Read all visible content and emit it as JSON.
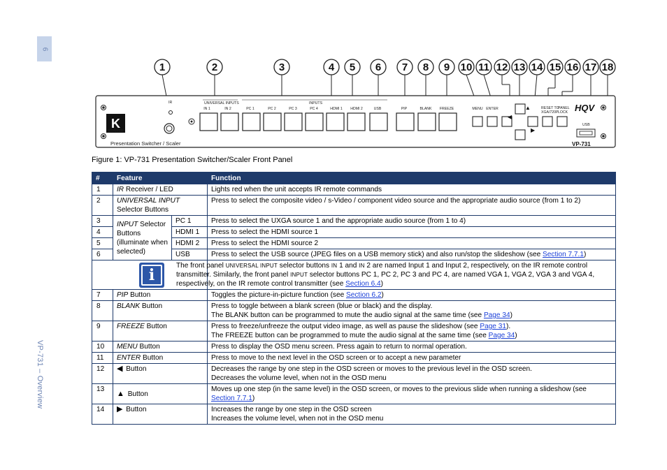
{
  "page": {
    "number": "6",
    "side_caption": "VP-731 – Overview"
  },
  "panel": {
    "callouts": [
      "1",
      "2",
      "3",
      "4",
      "5",
      "6",
      "7",
      "8",
      "9",
      "10",
      "11",
      "12",
      "13",
      "14",
      "15",
      "16",
      "17",
      "18"
    ],
    "ir_label": "IR",
    "universal_inputs_label": "UNIVERSAL INPUTS",
    "inputs_label": "INPUTS",
    "button_labels": [
      "IN 1",
      "IN 2",
      "PC 1",
      "PC 2",
      "PC 3",
      "PC 4",
      "HDMI 1",
      "HDMI 2",
      "USB",
      "PIP",
      "BLANK",
      "FREEZE",
      "MENU",
      "ENTER"
    ],
    "reset_label": "RESET TO",
    "reset_label2": "XGA/720P",
    "panel_lock_label": "PANEL",
    "panel_lock_label2": "LOCK",
    "usb_label": "USB",
    "hqv_logo": "HQV",
    "model": "VP-731",
    "brand_caption": "Presentation Switcher / Scaler",
    "brand_small": "KRAMER"
  },
  "figure_caption": "Figure 1: VP-731 Presentation Switcher/Scaler Front Panel",
  "table": {
    "headers": [
      "#",
      "Feature",
      "Function"
    ],
    "rows": {
      "r1": {
        "num": "1",
        "feature_em": "IR",
        "feature": " Receiver / LED",
        "function": "Lights red when the unit accepts IR remote commands"
      },
      "r2": {
        "num": "2",
        "feature_em": "UNIVERSAL INPUT",
        "feature": "Selector Buttons",
        "function": "Press to select the composite video / s-Video / component video source and the appropriate audio source (from 1 to 2)"
      },
      "r3": {
        "num": "3",
        "group_em": "INPUT",
        "group": " Selector Buttons (illuminate when selected)",
        "sub": "PC 1",
        "function": "Press to select the UXGA source 1 and the appropriate audio source (from 1 to 4)"
      },
      "r4": {
        "num": "4",
        "sub": "HDMI 1",
        "function": "Press to select the HDMI source 1"
      },
      "r5": {
        "num": "5",
        "sub": "HDMI 2",
        "function": "Press to select the HDMI source 2"
      },
      "r6": {
        "num": "6",
        "sub": "USB",
        "function": "Press to select the USB source (JPEG files on a USB memory stick) and also run/stop the slideshow (see ",
        "link": "Section 7.7.1",
        "tail": ")"
      },
      "note": {
        "t1": "The front panel ",
        "sc1": "UNIVERSAL INPUT",
        "t2": " selector buttons ",
        "sc2": "IN",
        "t3": " 1 and ",
        "sc3": "IN",
        "t4": " 2 are named Input 1 and Input 2, respectively, on the IR remote control transmitter. Similarly, the front panel ",
        "sc4": "INPUT",
        "t5": " selector buttons PC 1, PC 2, PC 3 and PC 4, are named VGA 1, VGA 2, VGA 3 and VGA 4, respectively, on the IR remote control transmitter (see ",
        "link": "Section 6.4",
        "t6": ")"
      },
      "r7": {
        "num": "7",
        "feature_em": "PIP",
        "feature": " Button",
        "function": "Toggles the picture-in-picture function (see ",
        "link": "Section 6.2",
        "tail": ")"
      },
      "r8": {
        "num": "8",
        "feature_em": "BLANK",
        "feature": " Button",
        "function1": "Press to toggle between a blank screen (blue or black) and the display.",
        "function2": "The BLANK button can be programmed to mute the audio signal at the same time (see ",
        "link": "Page 34",
        "tail": ")"
      },
      "r9": {
        "num": "9",
        "feature_em": "FREEZE",
        "feature": " Button",
        "function1": "Press to freeze/unfreeze the output video image, as well as pause the slideshow (see ",
        "link1": "Page 31",
        "tail1": ").",
        "function2": "The FREEZE button can be programmed to mute the audio signal at the same time (see ",
        "link2": "Page 34",
        "tail2": ")"
      },
      "r10": {
        "num": "10",
        "feature_em": "MENU",
        "feature": " Button",
        "function": "Press to display the OSD menu screen. Press again to return to normal operation."
      },
      "r11": {
        "num": "11",
        "feature_em": "ENTER",
        "feature": " Button",
        "function": "Press to move to the next level in the OSD screen or to accept a new parameter"
      },
      "r12": {
        "num": "12",
        "arrow": "◀",
        "feature": " Button",
        "function1": "Decreases the range by one step in the OSD screen or moves to the previous level in the OSD screen.",
        "function2": "Decreases the volume level, when not in the OSD menu"
      },
      "r13": {
        "num": "13",
        "arrow": "▲",
        "feature": " Button",
        "function": "Moves up one step (in the same level) in the OSD screen, or moves to the previous slide when running a slideshow (see ",
        "link": "Section 7.7.1",
        "tail": ")"
      },
      "r14": {
        "num": "14",
        "arrow": "▶",
        "feature": " Button",
        "function1": "Increases the range by one step in the OSD screen",
        "function2": "Increases the volume level, when not in the OSD menu"
      }
    }
  }
}
